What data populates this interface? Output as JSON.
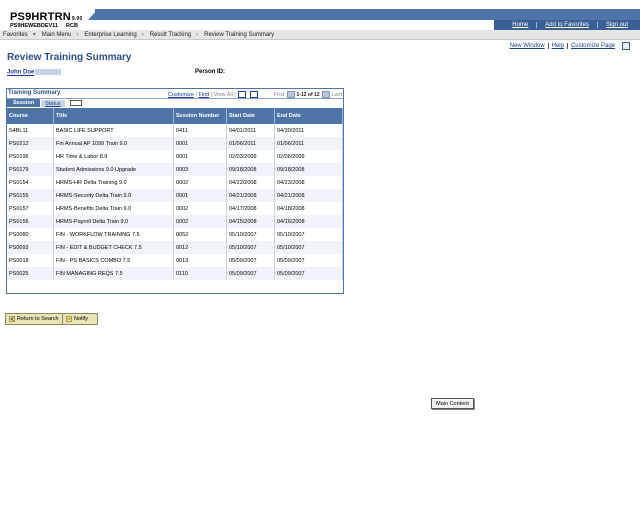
{
  "header": {
    "logo": "PS9HRTRN",
    "version": "9.00",
    "database": "PS9HEWEBDEV11",
    "db_suffix": "RCB",
    "links": [
      "Home",
      "Add to Favorites",
      "Sign out"
    ]
  },
  "nav": {
    "items": [
      "Favorites",
      "Main Menu",
      "Enterprise Learning",
      "Result Tracking",
      "Review Training Summary"
    ]
  },
  "toplinks": [
    "New Window",
    "Help",
    "Customize Page"
  ],
  "page": {
    "title": "Review Training Summary",
    "person_name": "John Doe",
    "person_id_label": "Person ID:"
  },
  "grid": {
    "title": "Training Summary",
    "customize": "Customize",
    "find": "Find",
    "view_all": "View All",
    "first": "First",
    "range": "1-12 of 12",
    "last": "Last",
    "tabs": [
      "Session",
      "Status"
    ],
    "columns": [
      "Course",
      "Title",
      "Session Number",
      "Start Date",
      "End Date"
    ],
    "rows": [
      [
        "S4BL11",
        "BASIC LIFE SUPPORT",
        "0411",
        "04/01/2011",
        "04/30/2011"
      ],
      [
        "PS0212",
        "Fin Annual AP 1099 Train 9.0",
        "0001",
        "01/06/2011",
        "01/06/2011"
      ],
      [
        "PS0196",
        "HR Time & Labor 8.9",
        "0001",
        "02/03/2009",
        "02/06/2009"
      ],
      [
        "PS0179",
        "Student Admissions 9.0 Upgrade",
        "0003",
        "09/18/2008",
        "09/18/2008"
      ],
      [
        "PS0154",
        "HRMS-HR Delta Training 9.0",
        "0002",
        "04/22/2008",
        "04/23/2008"
      ],
      [
        "PS0155",
        "HRMS-Security Delta Train 9.0",
        "0001",
        "04/21/2008",
        "04/21/2008"
      ],
      [
        "PS0157",
        "HRMS-Benefits Delta Train 9.0",
        "0002",
        "04/17/2008",
        "04/18/2008"
      ],
      [
        "PS0156",
        "HRMS-Payroll Delta Train 9.0",
        "0002",
        "04/15/2008",
        "04/16/2008"
      ],
      [
        "PS0080",
        "FIN - WORKFLOW TRAINING 7.5",
        "0052",
        "05/10/2007",
        "05/10/2007"
      ],
      [
        "PS0093",
        "FIN - EDIT & BUDGET CHECK 7.5",
        "0012",
        "05/10/2007",
        "05/10/2007"
      ],
      [
        "PS0018",
        "FIN - PS BASICS COMBO 7.5",
        "0013",
        "05/09/2007",
        "05/09/2007"
      ],
      [
        "PS0025",
        "FIN MANAGING REQS 7.5",
        "0110",
        "05/09/2007",
        "05/09/2007"
      ]
    ]
  },
  "buttons": {
    "return": "Return to Search",
    "notify": "Notify"
  },
  "tooltip": "Main Content",
  "colors": {
    "brand_blue": "#4f74a8",
    "title_blue": "#2b4f8d",
    "link_blue": "#1a3d8f"
  }
}
